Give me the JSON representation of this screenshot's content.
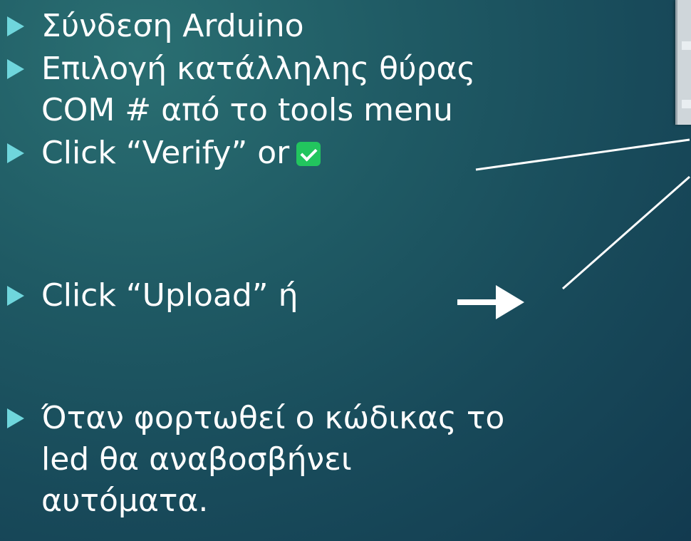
{
  "slide": {
    "bullets": [
      {
        "lines": [
          "Σύνδεση Arduino"
        ]
      },
      {
        "lines": [
          "Επιλογή κατάλληλης θύρας",
          "COM # από το tools menu"
        ]
      },
      {
        "lines": [
          "Click “Verify” or"
        ],
        "icon": "verify-check-icon"
      },
      {
        "lines": [
          "Click “Upload” ή"
        ],
        "icon": "upload-arrow-icon"
      },
      {
        "lines": [
          "Όταν φορτωθεί ο κώδικας το",
          "led θα αναβοσβήνει",
          "αυτόματα."
        ]
      }
    ]
  },
  "colors": {
    "background": "#1f5a64",
    "bullet_marker": "#6fd6dc",
    "verify_icon": "#22c55e",
    "text": "#ffffff"
  }
}
